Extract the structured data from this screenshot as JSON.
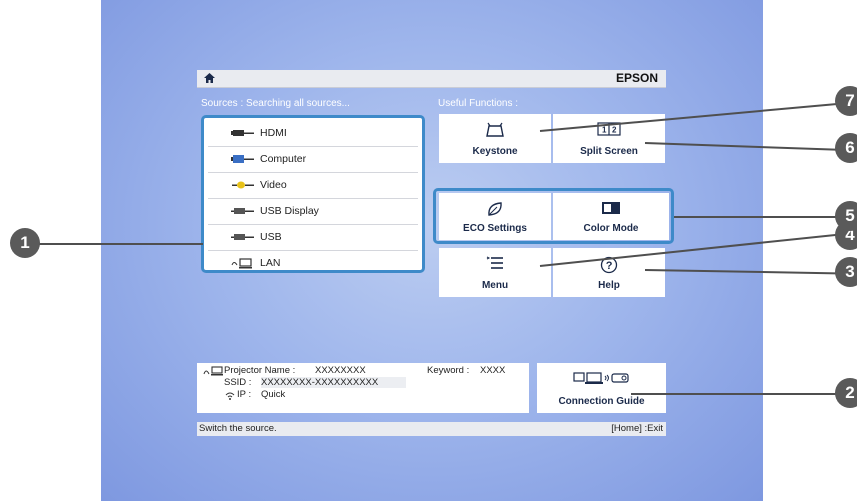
{
  "header": {
    "brand": "EPSON",
    "home_icon": "home-icon"
  },
  "sources": {
    "label": "Sources :  Searching all sources...",
    "items": [
      {
        "label": "HDMI",
        "icon": "hdmi-icon"
      },
      {
        "label": "Computer",
        "icon": "computer-icon"
      },
      {
        "label": "Video",
        "icon": "video-icon"
      },
      {
        "label": "USB Display",
        "icon": "usb-display-icon"
      },
      {
        "label": "USB",
        "icon": "usb-icon"
      },
      {
        "label": "LAN",
        "icon": "lan-icon"
      }
    ]
  },
  "functions": {
    "label": "Useful Functions :",
    "keystone": "Keystone",
    "split_screen": "Split Screen",
    "eco_settings": "ECO Settings",
    "color_mode": "Color Mode",
    "menu": "Menu",
    "help": "Help"
  },
  "network": {
    "projector_name_label": "Projector Name :",
    "projector_name_value": "XXXXXXXX",
    "keyword_label": "Keyword :",
    "keyword_value": "XXXX",
    "ssid_label": "SSID  :",
    "ssid_value": "XXXXXXXX-XXXXXXXXXX",
    "ip_label": "IP  :",
    "ip_value": "Quick"
  },
  "connection_guide": "Connection Guide",
  "footer": {
    "hint": "Switch the source.",
    "exit": "[Home] :Exit"
  },
  "callouts": [
    "1",
    "2",
    "3",
    "4",
    "5",
    "6",
    "7"
  ],
  "colors": {
    "accent": "#3e8ac9",
    "callout": "#5a5a5a"
  }
}
